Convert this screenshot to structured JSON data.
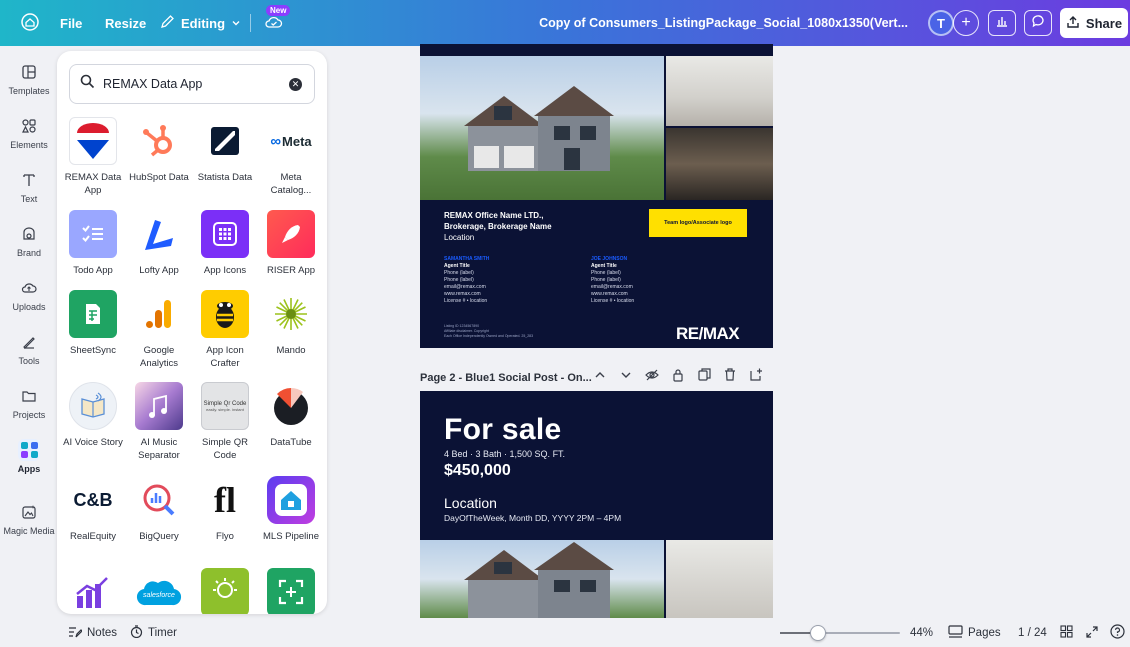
{
  "topbar": {
    "home_icon": "home-icon",
    "file_label": "File",
    "resize_label": "Resize",
    "editing_label": "Editing",
    "new_badge": "New",
    "doc_title": "Copy of Consumers_ListingPackage_Social_1080x1350(Vert...",
    "avatar_initial": "T",
    "share_label": "Share"
  },
  "rail": {
    "items": [
      {
        "label": "Templates",
        "icon": "templates-icon"
      },
      {
        "label": "Elements",
        "icon": "elements-icon"
      },
      {
        "label": "Text",
        "icon": "text-icon"
      },
      {
        "label": "Brand",
        "icon": "brand-icon"
      },
      {
        "label": "Uploads",
        "icon": "uploads-icon"
      },
      {
        "label": "Tools",
        "icon": "tools-icon"
      },
      {
        "label": "Projects",
        "icon": "projects-icon"
      },
      {
        "label": "Apps",
        "icon": "apps-icon"
      },
      {
        "label": "Magic Media",
        "icon": "magic-media-icon"
      }
    ],
    "active": "Apps"
  },
  "panel": {
    "search_value": "REMAX Data App",
    "apps": [
      {
        "label": "REMAX Data App"
      },
      {
        "label": "HubSpot Data"
      },
      {
        "label": "Statista Data"
      },
      {
        "label": "Meta Catalog..."
      },
      {
        "label": "Todo App"
      },
      {
        "label": "Lofty App"
      },
      {
        "label": "App Icons"
      },
      {
        "label": "RISER App"
      },
      {
        "label": "SheetSync"
      },
      {
        "label": "Google Analytics"
      },
      {
        "label": "App Icon Crafter"
      },
      {
        "label": "Mando"
      },
      {
        "label": "AI Voice Story"
      },
      {
        "label": "AI Music Separator"
      },
      {
        "label": "Simple QR Code"
      },
      {
        "label": "DataTube"
      },
      {
        "label": "RealEquity"
      },
      {
        "label": "BigQuery"
      },
      {
        "label": "Flyo"
      },
      {
        "label": "MLS Pipeline"
      }
    ],
    "icon_text": {
      "meta": "Meta",
      "realequity": "C&B",
      "qr_title": "Simple Qr Code",
      "qr_sub": "easily. simple. instant",
      "flyo": "fl",
      "salesforce": "salesforce"
    }
  },
  "page1": {
    "office_name": "REMAX Office Name  LTD.,",
    "brokerage": "Brokerage, Brokerage Name",
    "location": "Location",
    "team_logo": "Team logo/Associate logo",
    "agent1": {
      "name": "SAMANTHA SMITH",
      "title": "Agent Title",
      "lines": [
        "Phone (label)",
        "Phone (label)",
        "email@remax.com",
        "www.remax.com",
        "License # • location"
      ]
    },
    "agent2": {
      "name": "JOE JOHNSON",
      "title": "Agent Title",
      "lines": [
        "Phone (label)",
        "Phone (label)",
        "email@remax.com",
        "www.remax.com",
        "License # • location"
      ]
    },
    "disclaimer": [
      "Listing ID 1234567890",
      "Affiliate disclaimer. Copyright",
      "Each Office Independently Owned and Operated. 25_283"
    ],
    "logo": "RE/MAX"
  },
  "page2": {
    "header": "Page 2 - Blue1 Social Post - On...",
    "title": "For sale",
    "specs": "4 Bed · 3 Bath · 1,500 SQ. FT.",
    "price": "$450,000",
    "location": "Location",
    "datetime": "DayOfTheWeek, Month DD, YYYY 2PM – 4PM"
  },
  "bottom": {
    "notes_label": "Notes",
    "timer_label": "Timer",
    "zoom_percent": 44,
    "zoom_label": "44%",
    "pages_label": "Pages",
    "page_count": "1 / 24"
  },
  "colors": {
    "canvas_navy": "#0b1235",
    "remax_red": "#dc1c2e",
    "remax_blue": "#0043ce",
    "accent_purple": "#8b3dff",
    "team_logo_yellow": "#ffe000"
  }
}
